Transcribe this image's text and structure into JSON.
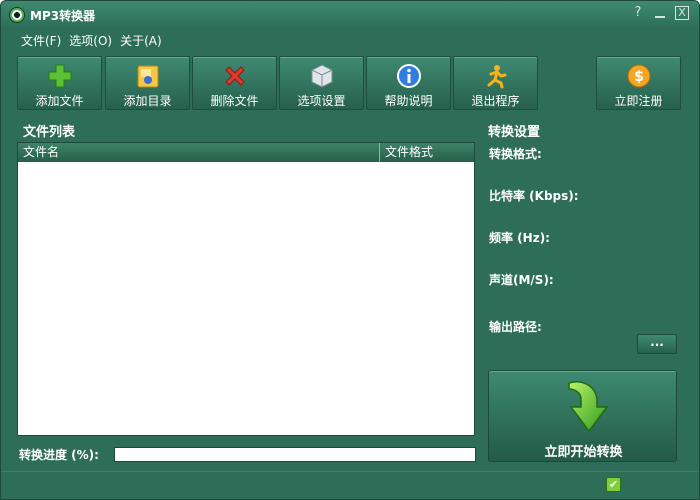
{
  "window": {
    "title": "MP3转换器"
  },
  "title_controls": {
    "help": "?",
    "close": "X"
  },
  "menu": [
    {
      "label": "文件(F)"
    },
    {
      "label": "选项(O)"
    },
    {
      "label": "关于(A)"
    }
  ],
  "toolbar": [
    {
      "label": "添加文件",
      "icon": "plus-icon"
    },
    {
      "label": "添加目录",
      "icon": "folder-icon"
    },
    {
      "label": "删除文件",
      "icon": "delete-x-icon"
    },
    {
      "label": "选项设置",
      "icon": "cube-icon"
    },
    {
      "label": "帮助说明",
      "icon": "info-icon"
    },
    {
      "label": "退出程序",
      "icon": "running-man-icon"
    },
    {
      "label": "立即注册",
      "icon": "coin-icon"
    }
  ],
  "file_list": {
    "title": "文件列表",
    "columns": [
      "文件名",
      "文件格式"
    ],
    "rows": []
  },
  "progress": {
    "label": "转换进度 (%):",
    "value": 0
  },
  "settings": {
    "title": "转换设置",
    "format_label": "转换格式:",
    "bitrate_label": "比特率 (Kbps):",
    "frequency_label": "频率 (Hz):",
    "channel_label": "声道(M/S):",
    "output_path_label": "输出路径:",
    "browse_label": "..."
  },
  "start_button": {
    "label": "立即开始转换",
    "icon": "green-down-arrow-icon"
  },
  "status": {
    "icon": "check-icon",
    "glyph": "✔"
  },
  "colors": {
    "window_bg": "#2e6e58",
    "accent": "#58b64a"
  }
}
